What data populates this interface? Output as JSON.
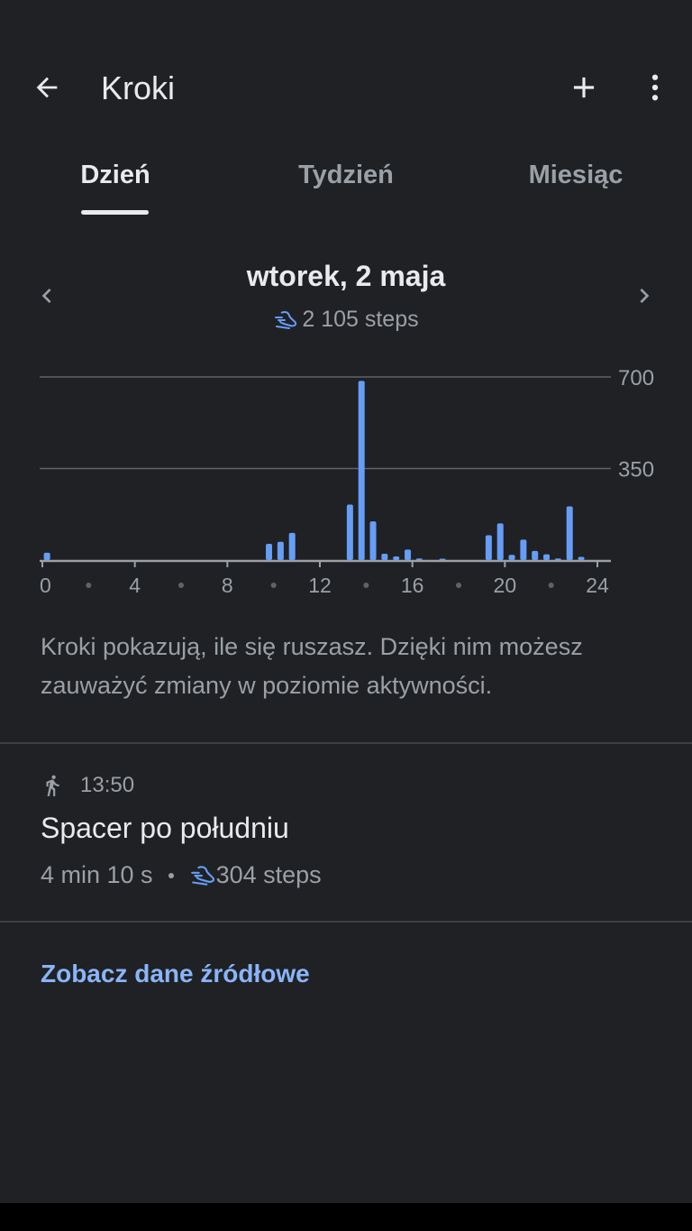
{
  "header": {
    "title": "Kroki",
    "back_icon": "arrow-back-icon",
    "add_icon": "plus-icon",
    "menu_icon": "more-vert-icon"
  },
  "tabs": [
    {
      "label": "Dzień",
      "active": true
    },
    {
      "label": "Tydzień",
      "active": false
    },
    {
      "label": "Miesiąc",
      "active": false
    }
  ],
  "date_nav": {
    "date": "wtorek, 2 maja",
    "steps": "2 105 steps",
    "prev_icon": "chevron-left-icon",
    "next_icon": "chevron-right-icon"
  },
  "chart_data": {
    "type": "bar",
    "x_unit": "hour",
    "xlim": [
      0,
      24
    ],
    "ylim": [
      0,
      700
    ],
    "y_ticks": [
      "700",
      "350"
    ],
    "x_ticks": [
      "0",
      "4",
      "8",
      "12",
      "16",
      "20",
      "24"
    ],
    "grid": true,
    "color": "#669df6",
    "x": [
      0.2,
      9.8,
      10.3,
      10.8,
      13.3,
      13.8,
      14.3,
      14.8,
      15.3,
      15.8,
      16.3,
      17.3,
      19.3,
      19.8,
      20.3,
      20.8,
      21.3,
      21.8,
      22.3,
      22.8,
      23.3
    ],
    "values": [
      28,
      62,
      70,
      104,
      212,
      685,
      148,
      24,
      14,
      40,
      6,
      5,
      95,
      140,
      20,
      78,
      35,
      22,
      6,
      205,
      12
    ]
  },
  "description": "Kroki pokazują, ile się ruszasz. Dzięki nim możesz zauważyć zmiany w poziomie aktywności.",
  "session": {
    "icon": "walking-person-icon",
    "time": "13:50",
    "title": "Spacer po południu",
    "duration": "4 min 10 s",
    "steps": "304 steps"
  },
  "source_link": "Zobacz dane źródłowe",
  "colors": {
    "background": "#202124",
    "accent": "#8ab4f8",
    "bar": "#669df6"
  }
}
